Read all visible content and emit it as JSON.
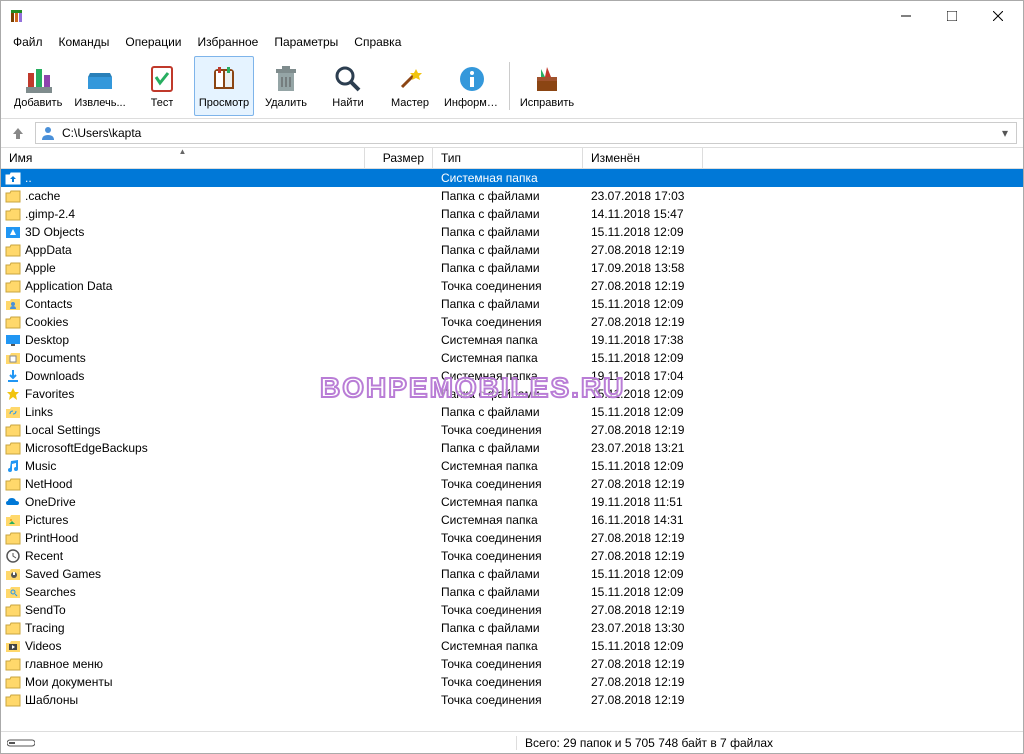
{
  "menubar": [
    "Файл",
    "Команды",
    "Операции",
    "Избранное",
    "Параметры",
    "Справка"
  ],
  "toolbar": [
    {
      "label": "Добавить",
      "icon": "add"
    },
    {
      "label": "Извлечь...",
      "icon": "extract"
    },
    {
      "label": "Тест",
      "icon": "test"
    },
    {
      "label": "Просмотр",
      "icon": "view",
      "active": true
    },
    {
      "label": "Удалить",
      "icon": "delete"
    },
    {
      "label": "Найти",
      "icon": "find"
    },
    {
      "label": "Мастер",
      "icon": "wizard"
    },
    {
      "label": "Информация",
      "icon": "info"
    },
    {
      "label": "_sep"
    },
    {
      "label": "Исправить",
      "icon": "repair"
    }
  ],
  "address": "C:\\Users\\kapta",
  "columns": {
    "name": "Имя",
    "size": "Размер",
    "type": "Тип",
    "date": "Изменён"
  },
  "files": [
    {
      "icon": "up",
      "name": "..",
      "type": "Системная папка",
      "date": "",
      "selected": true
    },
    {
      "icon": "folder",
      "name": ".cache",
      "type": "Папка с файлами",
      "date": "23.07.2018 17:03"
    },
    {
      "icon": "folder",
      "name": ".gimp-2.4",
      "type": "Папка с файлами",
      "date": "14.11.2018 15:47"
    },
    {
      "icon": "3d",
      "name": "3D Objects",
      "type": "Папка с файлами",
      "date": "15.11.2018 12:09"
    },
    {
      "icon": "folder",
      "name": "AppData",
      "type": "Папка с файлами",
      "date": "27.08.2018 12:19"
    },
    {
      "icon": "folder",
      "name": "Apple",
      "type": "Папка с файлами",
      "date": "17.09.2018 13:58"
    },
    {
      "icon": "folder",
      "name": "Application Data",
      "type": "Точка соединения",
      "date": "27.08.2018 12:19"
    },
    {
      "icon": "contacts",
      "name": "Contacts",
      "type": "Папка с файлами",
      "date": "15.11.2018 12:09"
    },
    {
      "icon": "folder",
      "name": "Cookies",
      "type": "Точка соединения",
      "date": "27.08.2018 12:19"
    },
    {
      "icon": "desktop",
      "name": "Desktop",
      "type": "Системная папка",
      "date": "19.11.2018 17:38"
    },
    {
      "icon": "documents",
      "name": "Documents",
      "type": "Системная папка",
      "date": "15.11.2018 12:09"
    },
    {
      "icon": "downloads",
      "name": "Downloads",
      "type": "Системная папка",
      "date": "19.11.2018 17:04"
    },
    {
      "icon": "favorites",
      "name": "Favorites",
      "type": "Папка с файлами",
      "date": "15.11.2018 12:09"
    },
    {
      "icon": "links",
      "name": "Links",
      "type": "Папка с файлами",
      "date": "15.11.2018 12:09"
    },
    {
      "icon": "folder",
      "name": "Local Settings",
      "type": "Точка соединения",
      "date": "27.08.2018 12:19"
    },
    {
      "icon": "folder",
      "name": "MicrosoftEdgeBackups",
      "type": "Папка с файлами",
      "date": "23.07.2018 13:21"
    },
    {
      "icon": "music",
      "name": "Music",
      "type": "Системная папка",
      "date": "15.11.2018 12:09"
    },
    {
      "icon": "folder",
      "name": "NetHood",
      "type": "Точка соединения",
      "date": "27.08.2018 12:19"
    },
    {
      "icon": "onedrive",
      "name": "OneDrive",
      "type": "Системная папка",
      "date": "19.11.2018 11:51"
    },
    {
      "icon": "pictures",
      "name": "Pictures",
      "type": "Системная папка",
      "date": "16.11.2018 14:31"
    },
    {
      "icon": "folder",
      "name": "PrintHood",
      "type": "Точка соединения",
      "date": "27.08.2018 12:19"
    },
    {
      "icon": "recent",
      "name": "Recent",
      "type": "Точка соединения",
      "date": "27.08.2018 12:19"
    },
    {
      "icon": "saved",
      "name": "Saved Games",
      "type": "Папка с файлами",
      "date": "15.11.2018 12:09"
    },
    {
      "icon": "searches",
      "name": "Searches",
      "type": "Папка с файлами",
      "date": "15.11.2018 12:09"
    },
    {
      "icon": "folder",
      "name": "SendTo",
      "type": "Точка соединения",
      "date": "27.08.2018 12:19"
    },
    {
      "icon": "folder",
      "name": "Tracing",
      "type": "Папка с файлами",
      "date": "23.07.2018 13:30"
    },
    {
      "icon": "videos",
      "name": "Videos",
      "type": "Системная папка",
      "date": "15.11.2018 12:09"
    },
    {
      "icon": "folder",
      "name": "главное меню",
      "type": "Точка соединения",
      "date": "27.08.2018 12:19"
    },
    {
      "icon": "folder",
      "name": "Мои документы",
      "type": "Точка соединения",
      "date": "27.08.2018 12:19"
    },
    {
      "icon": "folder",
      "name": "Шаблоны",
      "type": "Точка соединения",
      "date": "27.08.2018 12:19"
    }
  ],
  "status": "Всего: 29 папок и 5 705 748 байт в 7 файлах",
  "watermark": "BOHPEMOBILES.RU"
}
